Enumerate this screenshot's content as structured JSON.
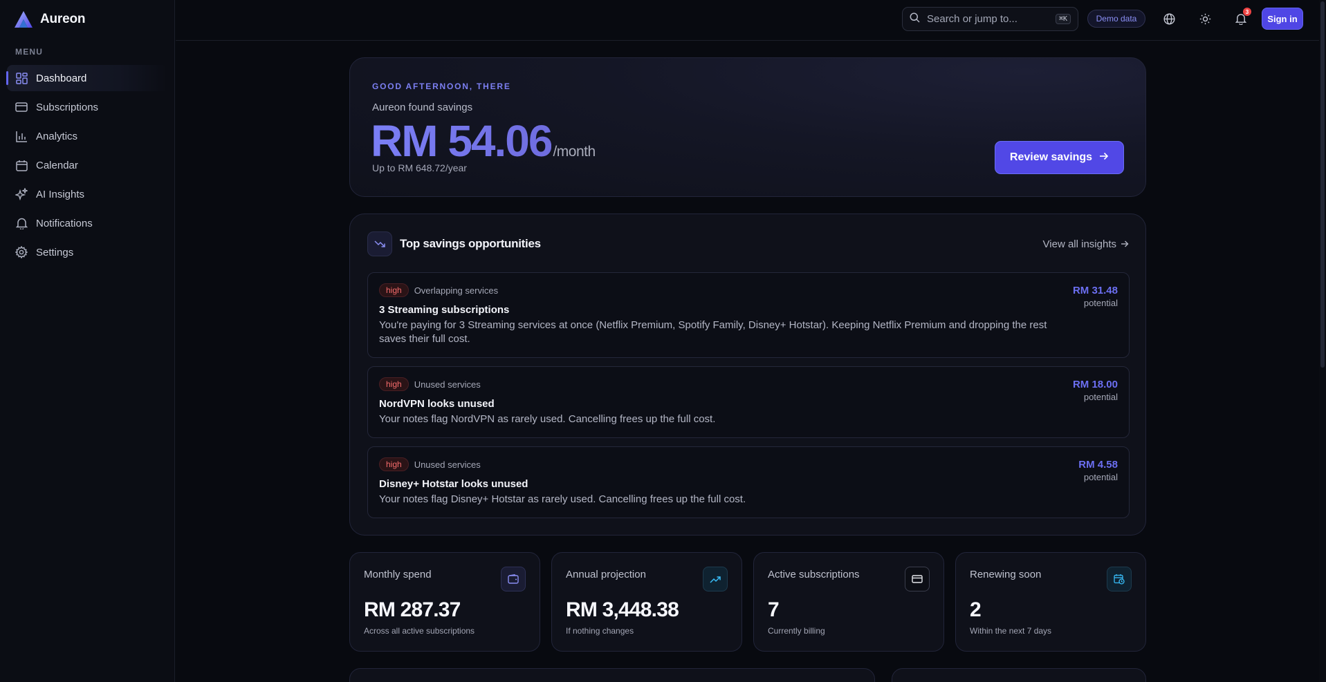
{
  "app": {
    "name": "Aureon"
  },
  "sidebar": {
    "menu_label": "MENU",
    "items": [
      {
        "label": "Dashboard",
        "icon": "dashboard-grid-icon",
        "active": true
      },
      {
        "label": "Subscriptions",
        "icon": "card-icon"
      },
      {
        "label": "Analytics",
        "icon": "bar-chart-icon"
      },
      {
        "label": "Calendar",
        "icon": "calendar-icon"
      },
      {
        "label": "AI Insights",
        "icon": "sparkles-icon"
      },
      {
        "label": "Notifications",
        "icon": "bell-icon"
      },
      {
        "label": "Settings",
        "icon": "gear-icon"
      }
    ]
  },
  "topbar": {
    "search_placeholder": "Search or jump to...",
    "search_shortcut": "⌘K",
    "demo_badge": "Demo data",
    "notification_count": "3",
    "signin_label": "Sign in"
  },
  "hero": {
    "greeting": "GOOD AFTERNOON, THERE",
    "found_label": "Aureon found savings",
    "amount": "RM 54.06",
    "per_period": "/month",
    "yearly": "Up to RM 648.72/year",
    "review_label": "Review savings"
  },
  "opportunities": {
    "title": "Top savings opportunities",
    "view_all": "View all insights",
    "items": [
      {
        "priority": "high",
        "category": "Overlapping services",
        "title": "3 Streaming subscriptions",
        "description": "You're paying for 3 Streaming services at once (Netflix Premium, Spotify Family, Disney+ Hotstar). Keeping Netflix Premium and dropping the rest saves their full cost.",
        "amount": "RM 31.48",
        "amount_label": "potential"
      },
      {
        "priority": "high",
        "category": "Unused services",
        "title": "NordVPN looks unused",
        "description": "Your notes flag NordVPN as rarely used. Cancelling frees up the full cost.",
        "amount": "RM 18.00",
        "amount_label": "potential"
      },
      {
        "priority": "high",
        "category": "Unused services",
        "title": "Disney+ Hotstar looks unused",
        "description": "Your notes flag Disney+ Hotstar as rarely used. Cancelling frees up the full cost.",
        "amount": "RM 4.58",
        "amount_label": "potential"
      }
    ]
  },
  "stats": [
    {
      "label": "Monthly spend",
      "value": "RM 287.37",
      "sub": "Across all active subscriptions",
      "icon": "wallet-icon",
      "accent": "#7c7ff2"
    },
    {
      "label": "Annual projection",
      "value": "RM 3,448.38",
      "sub": "If nothing changes",
      "icon": "trending-up-icon",
      "accent": "#38bdf8"
    },
    {
      "label": "Active subscriptions",
      "value": "7",
      "sub": "Currently billing",
      "icon": "card-icon",
      "accent": "#e5e7eb"
    },
    {
      "label": "Renewing soon",
      "value": "2",
      "sub": "Within the next 7 days",
      "icon": "calendar-clock-icon",
      "accent": "#38bdf8"
    }
  ],
  "colors": {
    "accent": "#6366f1",
    "background": "#080a10",
    "danger": "#f46b6b"
  }
}
